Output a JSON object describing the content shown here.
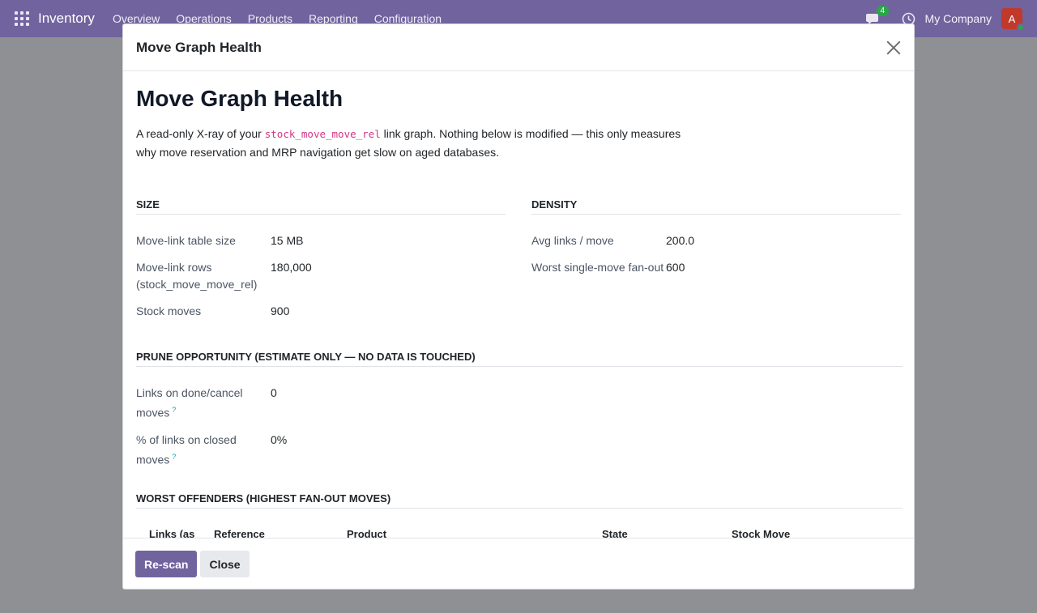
{
  "navbar": {
    "brand": "Inventory",
    "menu": [
      "Overview",
      "Operations",
      "Products",
      "Reporting",
      "Configuration"
    ],
    "chat_badge": "4",
    "company": "My Company",
    "avatar_initial": "A"
  },
  "modal": {
    "title": "Move Graph Health",
    "heading": "Move Graph Health",
    "intro_before": "A read-only X-ray of your ",
    "intro_code": "stock_move_move_rel",
    "intro_after": " link graph. Nothing below is modified — this only measures why move reservation and MRP navigation get slow on aged databases.",
    "size": {
      "title": "SIZE",
      "fields": [
        {
          "label": "Move-link table size",
          "value": "15 MB"
        },
        {
          "label": "Move-link rows (stock_move_move_rel)",
          "value": "180,000"
        },
        {
          "label": "Stock moves",
          "value": "900"
        }
      ]
    },
    "density": {
      "title": "DENSITY",
      "fields": [
        {
          "label": "Avg links / move",
          "value": "200.0"
        },
        {
          "label": "Worst single-move fan-out",
          "value": "600"
        }
      ]
    },
    "prune": {
      "title": "PRUNE OPPORTUNITY (ESTIMATE ONLY — NO DATA IS TOUCHED)",
      "fields": [
        {
          "label": "Links on done/cancel moves",
          "value": "0",
          "help": "?"
        },
        {
          "label": "% of links on closed moves",
          "value": "0%",
          "help": "?"
        }
      ]
    },
    "offenders": {
      "title": "WORST OFFENDERS (HIGHEST FAN-OUT MOVES)",
      "columns": [
        "Links (as",
        "Reference",
        "Product",
        "State",
        "Stock Move"
      ]
    },
    "buttons": {
      "rescan": "Re-scan",
      "close": "Close"
    }
  }
}
